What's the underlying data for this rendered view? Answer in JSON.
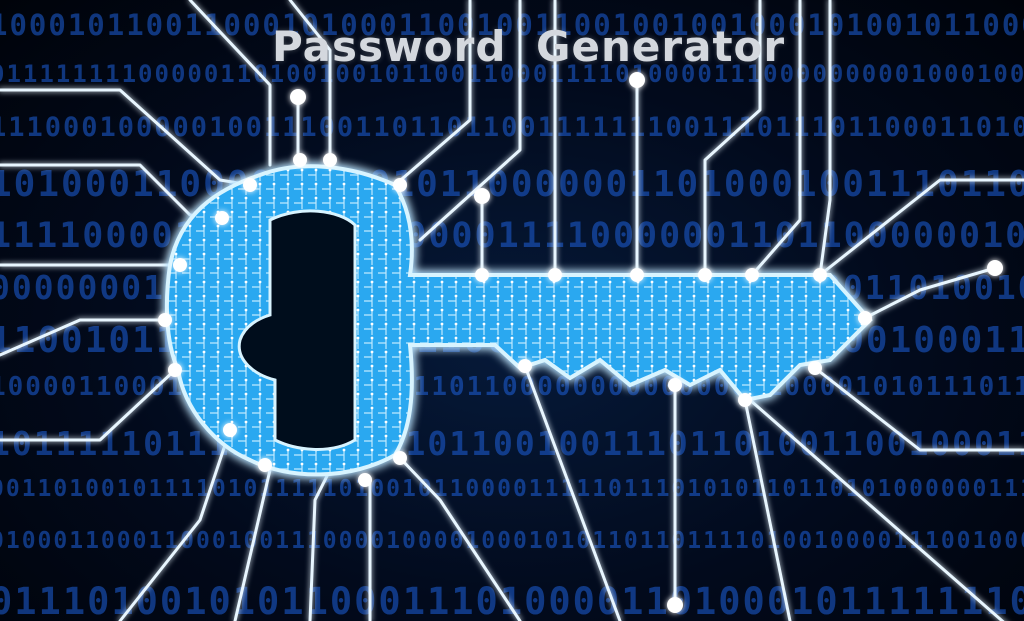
{
  "title": "Password Generator",
  "colors": {
    "background": "#020a1c",
    "glow": "#4fc8ff",
    "line": "#e8f6ff",
    "binary": "#1d5fd8",
    "title": "#d4d8de"
  },
  "image": {
    "subject": "key-circuit-icon"
  }
}
